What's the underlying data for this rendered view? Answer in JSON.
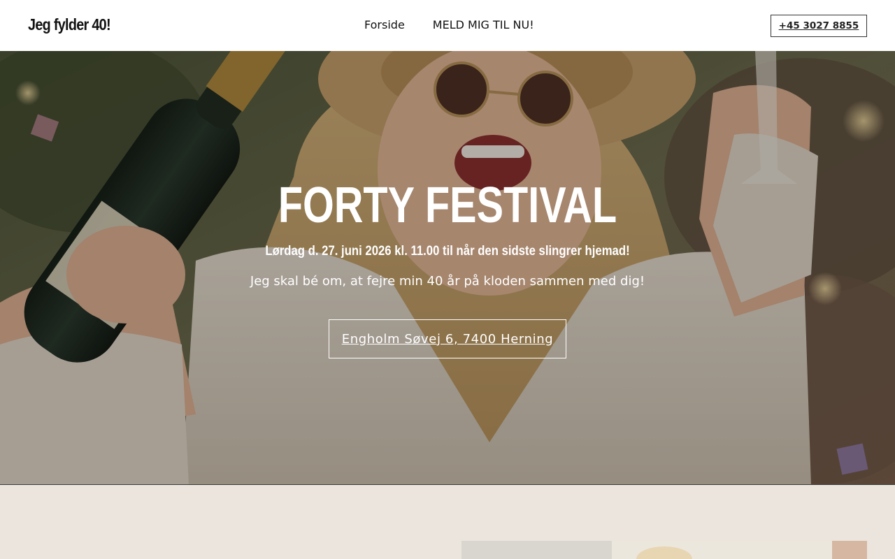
{
  "header": {
    "brand": "Jeg fylder 40!",
    "nav": [
      "Forside",
      "MELD MIG TIL NU!"
    ],
    "phone": "+45 3027 8855"
  },
  "hero": {
    "title": "FORTY FESTIVAL",
    "date_line": "Lørdag d. 27. juni 2026 kl. 11.00 til når den sidste slingrer hjemad!",
    "subtitle": "Jeg skal bé om, at fejre min 40 år på kloden sammen med dig!",
    "address_button": "Engholm Søvej 6, 7400 Herning"
  },
  "colors": {
    "header_bg": "#ffffff",
    "section2_bg": "#ebe5de",
    "hero_text": "#ffffff"
  }
}
